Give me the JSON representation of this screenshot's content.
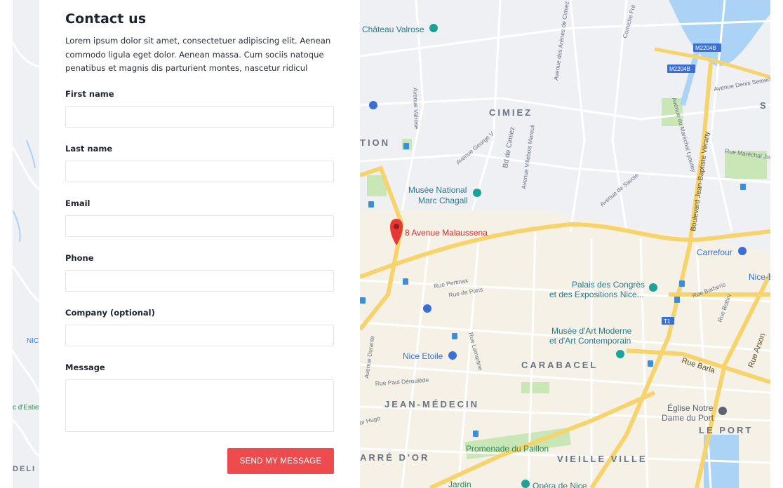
{
  "contact": {
    "title": "Contact us",
    "intro": "Lorem ipsum dolor sit amet, consectetuer adipiscing elit. Aenean commodo ligula eget dolor. Aenean massa. Cum sociis natoque penatibus et magnis dis parturient montes, nascetur ridicul",
    "fields": {
      "first_name": {
        "label": "First name",
        "value": ""
      },
      "last_name": {
        "label": "Last name",
        "value": ""
      },
      "email": {
        "label": "Email",
        "value": ""
      },
      "phone": {
        "label": "Phone",
        "value": ""
      },
      "company": {
        "label": "Company (optional)",
        "value": ""
      },
      "message": {
        "label": "Message",
        "value": ""
      }
    },
    "send_label": "SEND MY MESSAGE"
  },
  "map": {
    "marker_label": "8 Avenue Malaussena",
    "districts": {
      "cimiez": "CIMIEZ",
      "carabacel": "CARABACEL",
      "jean_medecin": "JEAN-MÉDECIN",
      "vieille_ville": "VIEILLE VILLE",
      "le_port": "LE PORT",
      "tion": "TION",
      "arre_dor": "ARRÉ D'OR",
      "s": "S",
      "deli": "DELI",
      "nic": "NIC"
    },
    "pois": {
      "chateau_valrose": "Château Valrose",
      "musee_chagall_1": "Musée National",
      "musee_chagall_2": "Marc Chagall",
      "palais_1": "Palais des Congrès",
      "palais_2": "et des Expositions Nice...",
      "mamac_1": "Musée d'Art Moderne",
      "mamac_2": "et d'Art Contemporain",
      "nice_etoile": "Nice Etoile",
      "carrefour": "Carrefour",
      "eglise_1": "Église Notre",
      "eglise_2": "Dame du Port",
      "promenade": "Promenade du Paillon",
      "jardin": "Jardin",
      "opera": "Opéra de Nice",
      "nice_e": "Nice-E",
      "estie": "c d'Estie"
    },
    "roads": {
      "m2204b_a": "M2204B",
      "m2204b_b": "M2204B",
      "rue_pertinax": "Rue Pertinax",
      "rue_de_paris": "Rue de Paris",
      "rue_barla": "Rue Barla",
      "rue_arson": "Rue Arson",
      "bd_cimiez": "Bd de Cimiez",
      "bd_jb_verany": "Boulevard Jean-Baptiste Vérany",
      "av_marechal_lyautey": "Avenue du Maréchal Lyautey",
      "av_valrose": "Avenue Valrose",
      "av_george_v": "Avenue George V",
      "av_villebois": "Avenue Villebois Mareuil",
      "av_arenes": "Avenue des Arènes de Cimiez",
      "av_savoie": "Avenue de Savoie",
      "av_denis_semeria": "Avenue Denis Semeria",
      "rue_marechal_joffre": "Rue Maréchal Joffre",
      "rue_pierre_deroulede": "Rue Paul Déroulède",
      "av_durante": "Avenue Durante",
      "rue_lamartine": "Rue Lamartine",
      "rue_hugo": "or Hugo",
      "rue_barberis": "Rue Barberis",
      "rue_bottini": "Rue Bottini",
      "corniche": "Corniche Fré",
      "t1": "T1"
    }
  }
}
